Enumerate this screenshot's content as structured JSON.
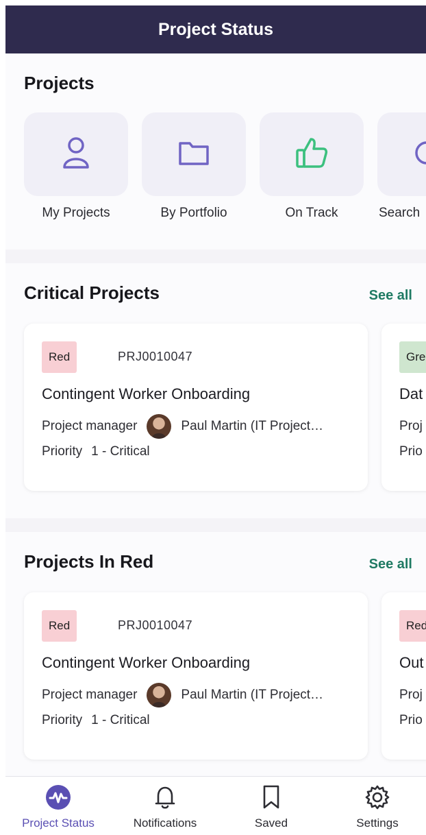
{
  "header": {
    "title": "Project Status"
  },
  "projects": {
    "title": "Projects",
    "items": [
      {
        "label": "My Projects",
        "icon": "person-icon"
      },
      {
        "label": "By Portfolio",
        "icon": "folder-icon"
      },
      {
        "label": "On Track",
        "icon": "thumbs-up-icon"
      },
      {
        "label": "Search",
        "icon": "search-icon"
      }
    ]
  },
  "critical": {
    "title": "Critical Projects",
    "see_all": "See all",
    "cards": [
      {
        "status": "Red",
        "number": "PRJ0010047",
        "name": "Contingent Worker Onboarding",
        "pm_label": "Project manager",
        "pm_name": "Paul Martin (IT Project…",
        "priority_label": "Priority",
        "priority": "1 - Critical"
      }
    ],
    "peek": {
      "status": "Gre",
      "name": "Dat",
      "pm_label": "Proj",
      "priority_label": "Prio"
    }
  },
  "red": {
    "title": "Projects In Red",
    "see_all": "See all",
    "cards": [
      {
        "status": "Red",
        "number": "PRJ0010047",
        "name": "Contingent Worker Onboarding",
        "pm_label": "Project manager",
        "pm_name": "Paul Martin (IT Project…",
        "priority_label": "Priority",
        "priority": "1 - Critical"
      }
    ],
    "peek": {
      "status": "Red",
      "name": "Out",
      "pm_label": "Proj",
      "priority_label": "Prio"
    }
  },
  "tabs": [
    {
      "label": "Project Status",
      "icon": "activity-icon",
      "active": true
    },
    {
      "label": "Notifications",
      "icon": "bell-icon"
    },
    {
      "label": "Saved",
      "icon": "bookmark-icon"
    },
    {
      "label": "Settings",
      "icon": "gear-icon"
    }
  ],
  "colors": {
    "appbar": "#2f2b4e",
    "accent": "#5a4fb3",
    "link": "#1f7a63",
    "badge_red": "#f8cfd4",
    "badge_green": "#cfe6cf",
    "icon_green": "#3cc07f"
  }
}
